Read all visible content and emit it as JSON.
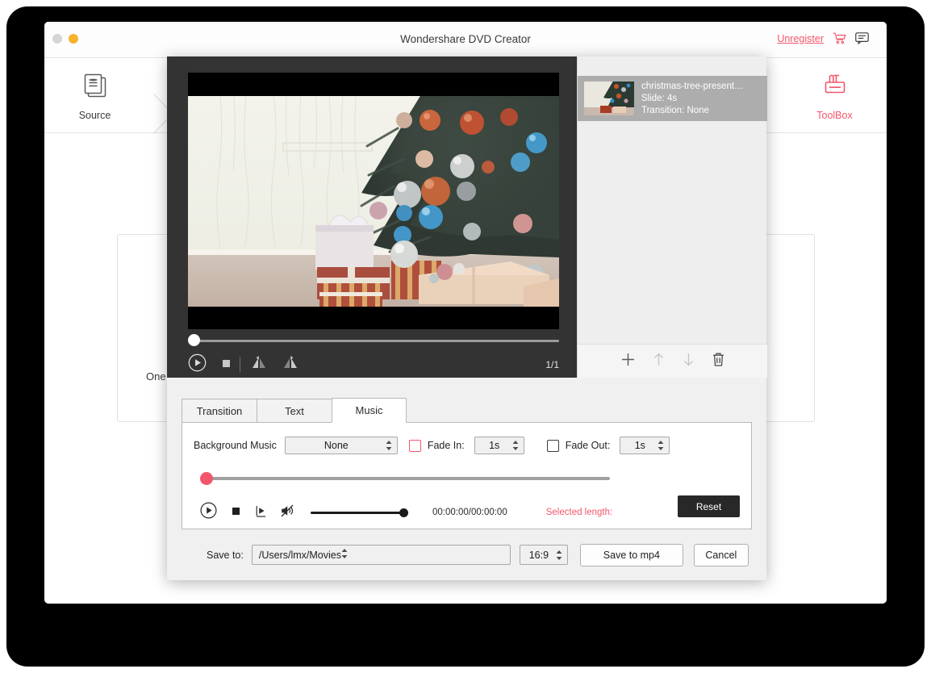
{
  "window": {
    "title": "Wondershare DVD Creator",
    "unregister_label": "Unregister",
    "cart_icon": "shopping-cart-icon",
    "feedback_icon": "chat-bubble-icon"
  },
  "ribbon": {
    "steps": [
      {
        "label": "Source",
        "icon": "documents-icon",
        "active": false
      },
      {
        "label": "ToolBox",
        "icon": "toolbox-icon",
        "active": true
      }
    ]
  },
  "background": {
    "partial_text": "One"
  },
  "preview": {
    "page_count": "1/1",
    "controls": [
      {
        "name": "play-button",
        "icon": "play-circle-icon"
      },
      {
        "name": "stop-button",
        "icon": "stop-square-icon"
      },
      {
        "name": "rotate-left-button",
        "icon": "rotate-left-icon"
      },
      {
        "name": "rotate-right-button",
        "icon": "rotate-right-icon"
      }
    ]
  },
  "thumbnails": {
    "items": [
      {
        "name": "christmas-tree-present…",
        "slide": "Slide: 4s",
        "transition": "Transition: None",
        "selected": true
      }
    ],
    "toolbar": [
      {
        "name": "add-button",
        "icon": "plus-icon",
        "enabled": true
      },
      {
        "name": "move-up-button",
        "icon": "arrow-up-icon",
        "enabled": false
      },
      {
        "name": "move-down-button",
        "icon": "arrow-down-icon",
        "enabled": false
      },
      {
        "name": "delete-button",
        "icon": "trash-icon",
        "enabled": true
      }
    ]
  },
  "tabs": [
    {
      "label": "Transition",
      "active": false
    },
    {
      "label": "Text",
      "active": false
    },
    {
      "label": "Music",
      "active": true
    }
  ],
  "music": {
    "bg_music_label": "Background Music",
    "bg_music_value": "None",
    "fade_in_label": "Fade In:",
    "fade_in_checked": false,
    "fade_in_value": "1s",
    "fade_out_label": "Fade Out:",
    "fade_out_checked": false,
    "fade_out_value": "1s",
    "timecode": "00:00:00/00:00:00",
    "selected_length_label": "Selected length:",
    "reset_label": "Reset",
    "transport": [
      {
        "name": "music-play-button",
        "icon": "play-circle-icon"
      },
      {
        "name": "music-stop-button",
        "icon": "stop-square-icon"
      },
      {
        "name": "music-export-button",
        "icon": "export-clip-icon"
      },
      {
        "name": "music-mute-button",
        "icon": "speaker-muted-icon"
      }
    ]
  },
  "footer": {
    "save_to_label": "Save to:",
    "save_path": "/Users/lmx/Movies",
    "aspect_ratio": "16:9",
    "save_button": "Save to mp4",
    "cancel_button": "Cancel"
  },
  "colors": {
    "accent": "#f4566b",
    "dark_panel": "#333333",
    "thumb_selected": "#adadad"
  }
}
